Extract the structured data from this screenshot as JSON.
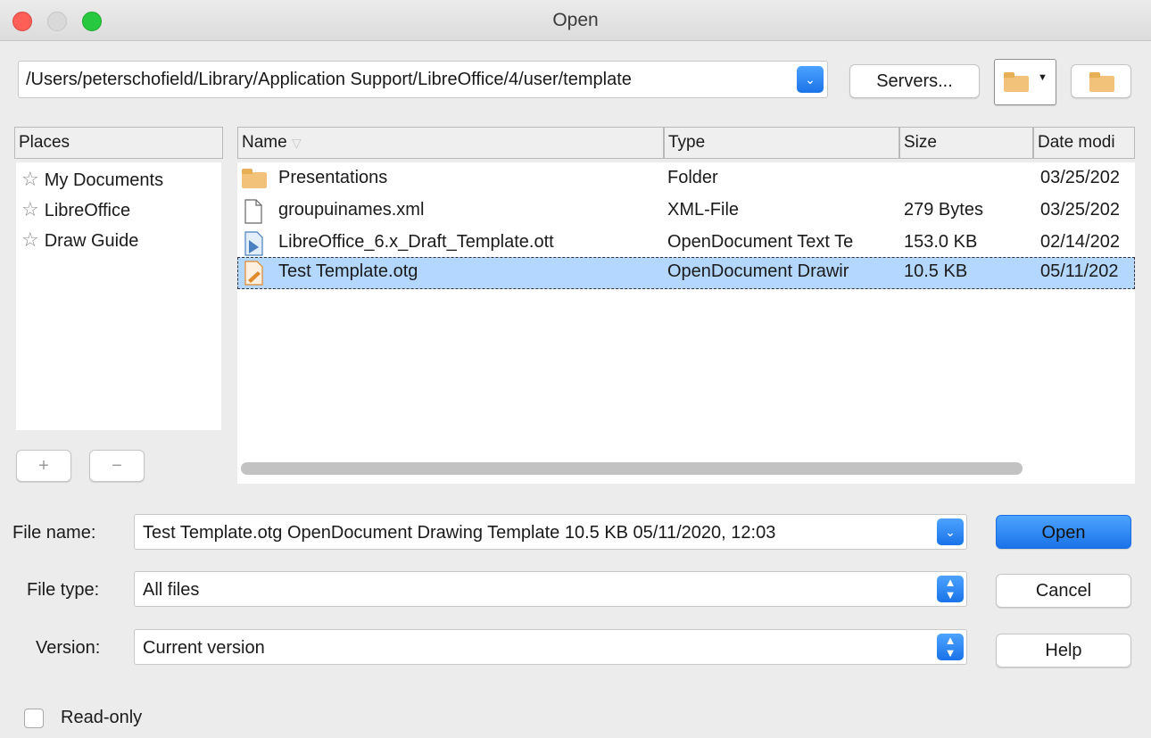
{
  "window": {
    "title": "Open"
  },
  "path": {
    "value": "/Users/peterschofield/Library/Application Support/LibreOffice/4/user/template"
  },
  "toolbar": {
    "servers_label": "Servers..."
  },
  "places": {
    "header": "Places",
    "items": [
      {
        "label": "My Documents",
        "icon": "star-icon"
      },
      {
        "label": "LibreOffice",
        "icon": "star-icon"
      },
      {
        "label": "Draw Guide",
        "icon": "star-icon"
      }
    ],
    "add_label": "+",
    "remove_label": "−"
  },
  "files": {
    "columns": [
      "Name",
      "Type",
      "Size",
      "Date modi"
    ],
    "sort_indicator": "▽",
    "rows": [
      {
        "name": "Presentations",
        "type": "Folder",
        "size": "",
        "date": "03/25/202",
        "icon": "folder-icon",
        "selected": false
      },
      {
        "name": "groupuinames.xml",
        "type": "XML-File",
        "size": "279 Bytes",
        "date": "03/25/202",
        "icon": "file-icon",
        "selected": false
      },
      {
        "name": "LibreOffice_6.x_Draft_Template.ott",
        "type": "OpenDocument Text Te",
        "size": "153.0 KB",
        "date": "02/14/202",
        "icon": "writer-template-icon",
        "selected": false
      },
      {
        "name": "Test Template.otg",
        "type": "OpenDocument Drawir",
        "size": "10.5 KB",
        "date": "05/11/202",
        "icon": "draw-template-icon",
        "selected": true
      }
    ]
  },
  "form": {
    "file_name_label": "File name:",
    "file_name_value": "Test Template.otg OpenDocument Drawing Template 10.5 KB 05/11/2020, 12:03",
    "file_type_label": "File type:",
    "file_type_value": "All files",
    "version_label": "Version:",
    "version_value": "Current version"
  },
  "actions": {
    "open_label": "Open",
    "cancel_label": "Cancel",
    "help_label": "Help"
  },
  "options": {
    "read_only_label": "Read-only",
    "read_only_checked": false
  },
  "colors": {
    "accent": "#1a73e8",
    "selection": "#b4d7ff"
  }
}
